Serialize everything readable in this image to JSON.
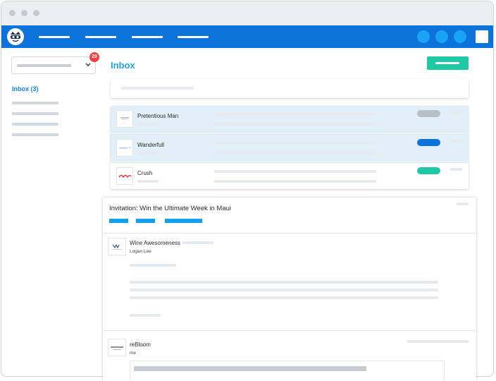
{
  "window": {
    "controls": [
      "close-dot",
      "minimize-dot",
      "maximize-dot"
    ]
  },
  "appbar": {
    "logo_icon": "mascot-logo-icon",
    "color": "#0b73d9",
    "nav_count": 4,
    "action_buttons": [
      "circle-button",
      "circle-button",
      "circle-button"
    ]
  },
  "sidebar": {
    "folder_select": {
      "chevron_icon": "chevron-down-icon"
    },
    "unread_badge": "20",
    "inbox_link": "Inbox (3)"
  },
  "main": {
    "title": "Inbox",
    "compose_color": "#1ec8a5",
    "messages": [
      {
        "sender": "Pretentious Man",
        "selected": true,
        "tag_color": "#b8bfc6"
      },
      {
        "sender": "Wanderfull",
        "selected": true,
        "tag_color": "#0b73d9"
      },
      {
        "sender": "Crush",
        "selected": false,
        "tag_color": "#1ec8a5"
      }
    ]
  },
  "reader": {
    "subject": "Invitation: Win the Ultimate Week in Maui",
    "emails": [
      {
        "from": "Wine Awesomeness",
        "to": "Logan Lee"
      },
      {
        "from": "reBloom",
        "to": "me"
      }
    ]
  }
}
